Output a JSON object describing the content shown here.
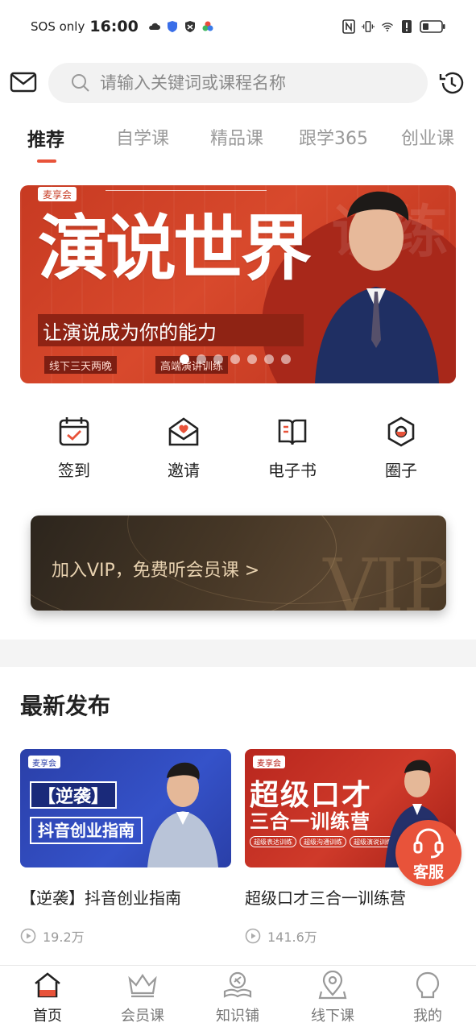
{
  "status_bar": {
    "carrier": "SOS only",
    "time": "16:00",
    "left_icons": [
      "cloud-sun-icon",
      "shield-icon",
      "vpn-icon",
      "color-wheel-icon"
    ],
    "right_icons": [
      "nfc-icon",
      "vibrate-icon",
      "wifi-icon",
      "alert-icon",
      "battery-icon"
    ]
  },
  "search": {
    "placeholder": "请输入关键词或课程名称"
  },
  "tabs": [
    {
      "label": "推荐",
      "active": true
    },
    {
      "label": "自学课",
      "active": false
    },
    {
      "label": "精品课",
      "active": false
    },
    {
      "label": "跟学365",
      "active": false
    },
    {
      "label": "创业课",
      "active": false
    }
  ],
  "banner": {
    "brand": "麦享会",
    "title": "演说世界",
    "slogan": "让演说成为你的能力",
    "tag_left": "线下三天两晚",
    "tag_right": "高端演讲训练",
    "dot_count": 7,
    "active_dot": 0
  },
  "quick_actions": [
    {
      "label": "签到",
      "icon": "calendar-check-icon"
    },
    {
      "label": "邀请",
      "icon": "envelope-heart-icon"
    },
    {
      "label": "电子书",
      "icon": "book-icon"
    },
    {
      "label": "圈子",
      "icon": "circle-hexagon-icon"
    }
  ],
  "vip": {
    "text": "加入VIP，免费听会员课 >",
    "watermark": "VIP"
  },
  "latest": {
    "title": "最新发布",
    "courses": [
      {
        "title": "【逆袭】抖音创业指南",
        "plays": "19.2万",
        "thumb_brand": "麦享会",
        "thumb_tag": "【逆袭】",
        "thumb_text": "抖音创业指南"
      },
      {
        "title": "超级口才三合一训练营",
        "plays": "141.6万",
        "thumb_brand": "麦享会",
        "thumb_line1": "超级口才",
        "thumb_line2": "三合一训练营",
        "thumb_pills": [
          "超级表达训练",
          "超级沟通训练",
          "超级演说训练"
        ]
      }
    ]
  },
  "customer_service": {
    "label": "客服"
  },
  "bottom_nav": [
    {
      "label": "首页",
      "icon": "home-icon",
      "active": true
    },
    {
      "label": "会员课",
      "icon": "crown-icon",
      "active": false
    },
    {
      "label": "知识铺",
      "icon": "knowledge-icon",
      "active": false
    },
    {
      "label": "线下课",
      "icon": "location-icon",
      "active": false
    },
    {
      "label": "我的",
      "icon": "profile-icon",
      "active": false
    }
  ],
  "colors": {
    "accent": "#e8533a",
    "banner_red": "#c73a22",
    "vip_gold": "#e8d2b0"
  }
}
